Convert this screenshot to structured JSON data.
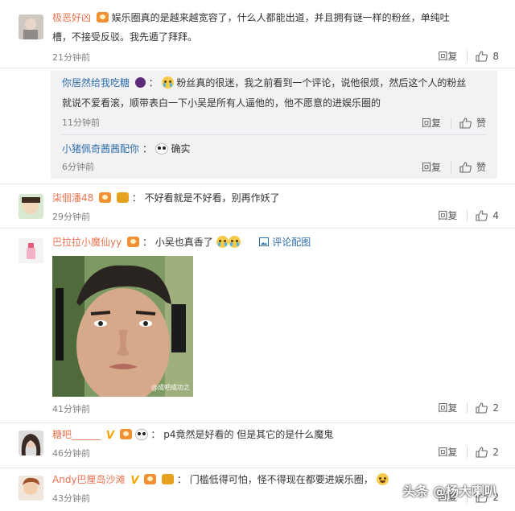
{
  "comments": [
    {
      "user": "极恶好凶",
      "text": "娱乐圈真的是越来越宽容了，什么人都能出道，并且拥有谜一样的粉丝，单纯吐",
      "text2": "槽，不接受反驳。我先遁了拜拜。",
      "time": "21分钟前",
      "reply": "回复",
      "likes": "8"
    },
    {
      "user": "柒個潘48",
      "text": "不好看就是不好看，别再作妖了",
      "time": "29分钟前",
      "reply": "回复",
      "likes": "4"
    },
    {
      "user": "巴拉拉小魔仙yy",
      "text": "小吴也真香了",
      "photo_link": "评论配图",
      "image_watermark": "@成吧成功之",
      "time": "41分钟前",
      "reply": "回复",
      "likes": "2"
    },
    {
      "user": "糖吧______",
      "text": "p4竟然是好看的 但是其它的是什么魔鬼",
      "time": "46分钟前",
      "reply": "回复",
      "likes": "2"
    },
    {
      "user": "Andy巴厘岛沙滩",
      "text": "门槛低得可怕，怪不得现在都要进娱乐圈，",
      "time": "43分钟前",
      "reply": "回复",
      "likes": "2"
    }
  ],
  "replies": [
    {
      "user": "你居然给我吃糖",
      "text": "粉丝真的很迷，我之前看到一个评论，说他很烦，然后这个人的粉丝",
      "text2": "就说不爱看滚，顺带表白一下小吴是所有人逼他的，他不愿意的进娱乐圈的",
      "time": "11分钟前",
      "reply": "回复",
      "like": "赞"
    },
    {
      "user": "小猪佩奇茜茜配你",
      "text": "确实",
      "time": "6分钟前",
      "reply": "回复",
      "like": "赞"
    }
  ],
  "watermark": "头条 @杨大喇叭",
  "colors": {
    "username": "#eb7350",
    "link": "#2f6da8",
    "reply_bg": "#f2f2f5"
  }
}
